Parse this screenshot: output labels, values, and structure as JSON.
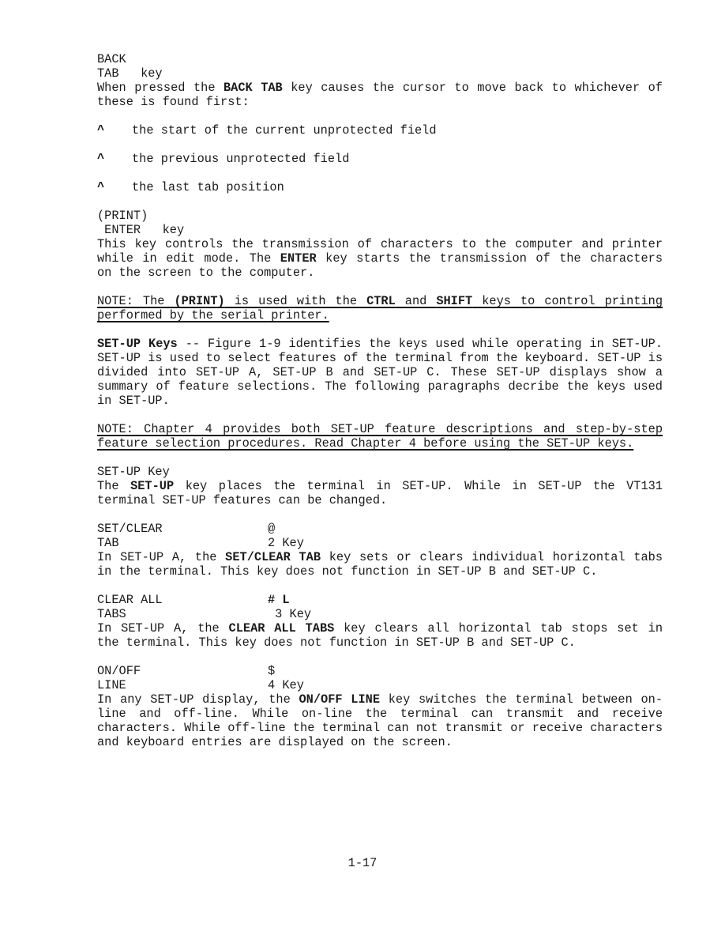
{
  "back_tab": {
    "title_line1": "BACK",
    "title_line2": "TAB   key",
    "desc_pre": "When pressed the ",
    "desc_bold": "BACK TAB",
    "desc_post": " key causes the cursor to move back to whichever of these is found first:",
    "bullet_glyph": "^",
    "bullets": [
      "the start of the current unprotected field",
      "the previous unprotected field",
      "the last tab position"
    ]
  },
  "print_enter": {
    "title_line1": "(PRINT)",
    "title_line2": " ENTER   key",
    "desc_pre": "This key controls the transmission of characters to the computer and printer while in edit mode. The ",
    "desc_bold": "ENTER",
    "desc_post": " key starts the transmission of the characters on the screen to the computer.",
    "note_pre": "NOTE: The ",
    "note_bold1": "(PRINT)",
    "note_mid1": " is used with the ",
    "note_bold2": "CTRL",
    "note_mid2": " and ",
    "note_bold3": "SHIFT",
    "note_post": " keys to control printing performed by the serial printer."
  },
  "setup_keys": {
    "heading_bold": "SET-UP Keys",
    "text": " -- Figure 1-9 identifies the keys used while operating in SET-UP. SET-UP is used to select features of the terminal from the keyboard. SET-UP is divided into SET-UP A, SET-UP B and SET-UP C. These SET-UP displays show a summary of feature selections. The following paragraphs decribe the keys used in SET-UP.",
    "note": "NOTE: Chapter 4 provides both SET-UP feature descriptions and step-by-step feature selection procedures. Read Chapter 4 before using the SET-UP keys."
  },
  "setup_key": {
    "title": "SET-UP Key",
    "desc_pre": "The ",
    "desc_bold": "SET-UP",
    "desc_post": " key places the terminal in SET-UP. While in SET-UP the VT131 terminal SET-UP features can be changed."
  },
  "set_clear_tab": {
    "label_line1": "SET/CLEAR",
    "label_line2": "TAB",
    "key_line1": "@",
    "key_line2": "2 Key",
    "desc_pre": "In SET-UP A, the ",
    "desc_bold": "SET/CLEAR TAB",
    "desc_post": " key sets or clears individual horizontal tabs in the terminal. This key does not function in SET-UP B and SET-UP C."
  },
  "clear_all_tabs": {
    "label_line1": "CLEAR ALL",
    "label_line2": "TABS",
    "key_line1": "# L",
    "key_line2": " 3 Key",
    "desc_pre": "In SET-UP A, the ",
    "desc_bold": "CLEAR ALL TABS",
    "desc_post": " key clears all horizontal tab stops set in the terminal. This key does not function in SET-UP B and SET-UP C."
  },
  "on_off_line": {
    "label_line1": "ON/OFF",
    "label_line2": "LINE",
    "key_line1": "$",
    "key_line2": "4 Key",
    "desc_pre": "In any SET-UP display, the ",
    "desc_bold": "ON/OFF LINE",
    "desc_post": " key switches the terminal between on-line and off-line. While on-line the terminal can transmit and receive characters. While off-line the terminal can not transmit or receive characters and keyboard entries are displayed on the screen."
  },
  "footer": {
    "page_number": "1-17"
  }
}
